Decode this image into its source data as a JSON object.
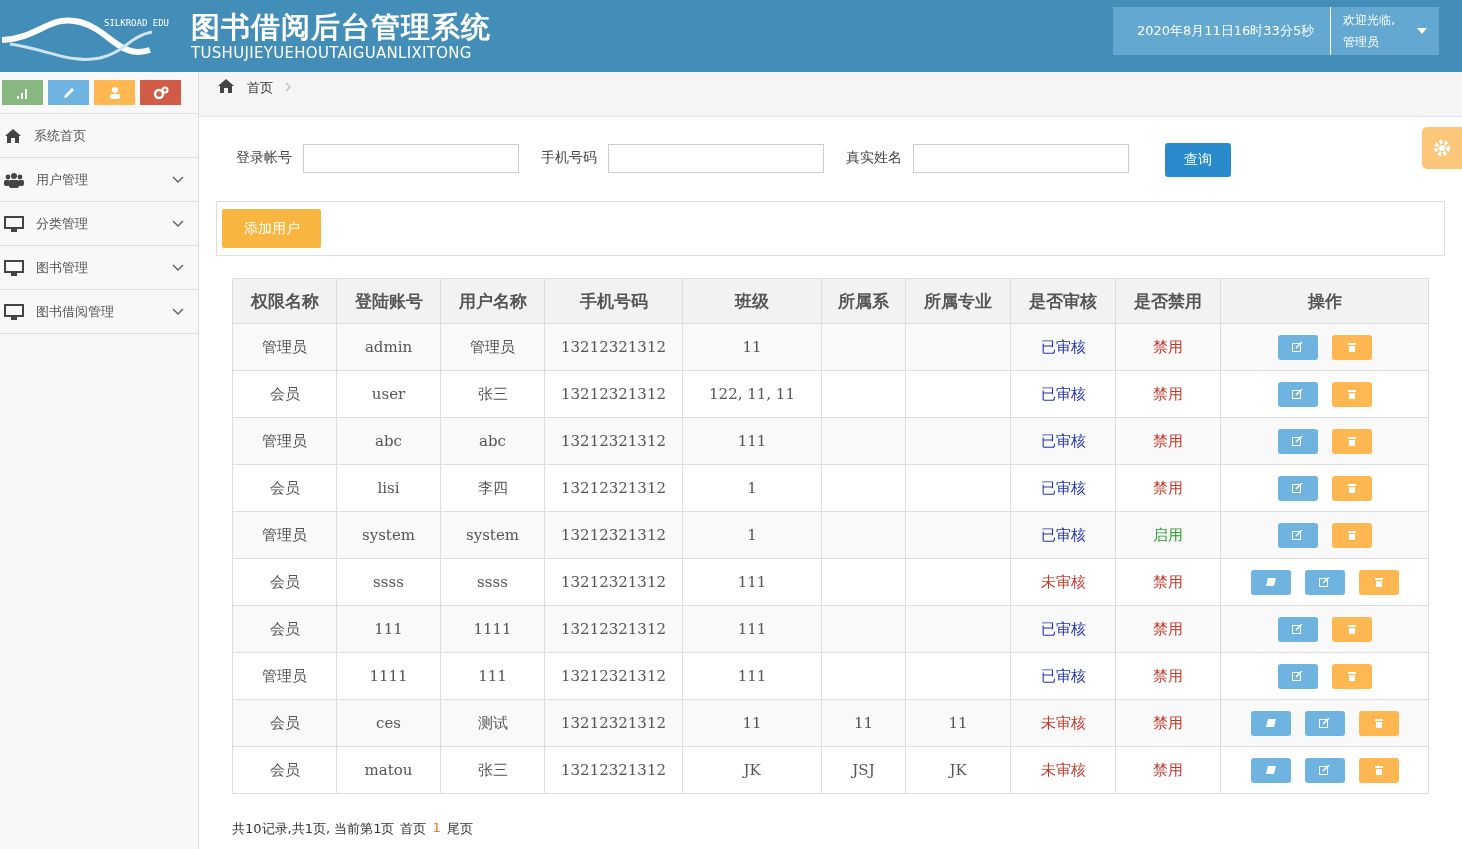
{
  "header": {
    "logo_text": "SILKROAD EDU",
    "title": "图书借阅后台管理系统",
    "subtitle": "TUSHUJIEYUEHOUTAIGUANLIXITONG",
    "datetime": "2020年8月11日16时33分5秒",
    "welcome": "欢迎光临,",
    "user": "管理员"
  },
  "shortcuts": [
    {
      "kind": "chart",
      "color": "#87b87f"
    },
    {
      "kind": "pencil",
      "color": "#6fb3e0"
    },
    {
      "kind": "users",
      "color": "#ffb752"
    },
    {
      "kind": "cogs",
      "color": "#d15b47"
    }
  ],
  "sidebar": {
    "items": [
      {
        "label": "系统首页",
        "kind": "link"
      },
      {
        "label": "用户管理",
        "kind": "menu"
      },
      {
        "label": "分类管理",
        "kind": "menu"
      },
      {
        "label": "图书管理",
        "kind": "menu"
      },
      {
        "label": "图书借阅管理",
        "kind": "menu"
      }
    ]
  },
  "breadcrumb": [
    "首页"
  ],
  "search": {
    "fields": [
      {
        "label": "登录帐号"
      },
      {
        "label": "手机号码"
      },
      {
        "label": "真实姓名"
      }
    ],
    "button": "查询"
  },
  "add_button": "添加用户",
  "table": {
    "columns": [
      "权限名称",
      "登陆账号",
      "用户名称",
      "手机号码",
      "班级",
      "所属系",
      "所属专业",
      "是否审核",
      "是否禁用",
      "操作"
    ],
    "rows": [
      {
        "cells": [
          "管理员",
          "admin",
          "管理员",
          "13212321312",
          "11",
          "",
          ""
        ],
        "audit": "已审核",
        "approved": true,
        "status": "禁用",
        "enabled": false
      },
      {
        "cells": [
          "会员",
          "user",
          "张三",
          "13212321312",
          "122, 11, 11",
          "",
          ""
        ],
        "audit": "已审核",
        "approved": true,
        "status": "禁用",
        "enabled": false
      },
      {
        "cells": [
          "管理员",
          "abc",
          "abc",
          "13212321312",
          "111",
          "",
          ""
        ],
        "audit": "已审核",
        "approved": true,
        "status": "禁用",
        "enabled": false
      },
      {
        "cells": [
          "会员",
          "lisi",
          "李四",
          "13212321312",
          "1",
          "",
          ""
        ],
        "audit": "已审核",
        "approved": true,
        "status": "禁用",
        "enabled": false
      },
      {
        "cells": [
          "管理员",
          "system",
          "system",
          "13212321312",
          "1",
          "",
          ""
        ],
        "audit": "已审核",
        "approved": true,
        "status": "启用",
        "enabled": true
      },
      {
        "cells": [
          "会员",
          "ssss",
          "ssss",
          "13212321312",
          "111",
          "",
          ""
        ],
        "audit": "未审核",
        "approved": false,
        "status": "禁用",
        "enabled": false
      },
      {
        "cells": [
          "会员",
          "111",
          "1111",
          "13212321312",
          "111",
          "",
          ""
        ],
        "audit": "已审核",
        "approved": true,
        "status": "禁用",
        "enabled": false
      },
      {
        "cells": [
          "管理员",
          "1111",
          "111",
          "13212321312",
          "111",
          "",
          ""
        ],
        "audit": "已审核",
        "approved": true,
        "status": "禁用",
        "enabled": false
      },
      {
        "cells": [
          "会员",
          "ces",
          "测试",
          "13212321312",
          "11",
          "11",
          "11"
        ],
        "audit": "未审核",
        "approved": false,
        "status": "禁用",
        "enabled": false
      },
      {
        "cells": [
          "会员",
          "matou",
          "张三",
          "13212321312",
          "JK",
          "JSJ",
          "JK"
        ],
        "audit": "未审核",
        "approved": false,
        "status": "禁用",
        "enabled": false
      }
    ]
  },
  "pagination": {
    "summary": "共10记录,共1页, 当前第1页",
    "first": "首页",
    "pages": [
      {
        "label": "1",
        "selected": true
      }
    ],
    "last": "尾页"
  }
}
